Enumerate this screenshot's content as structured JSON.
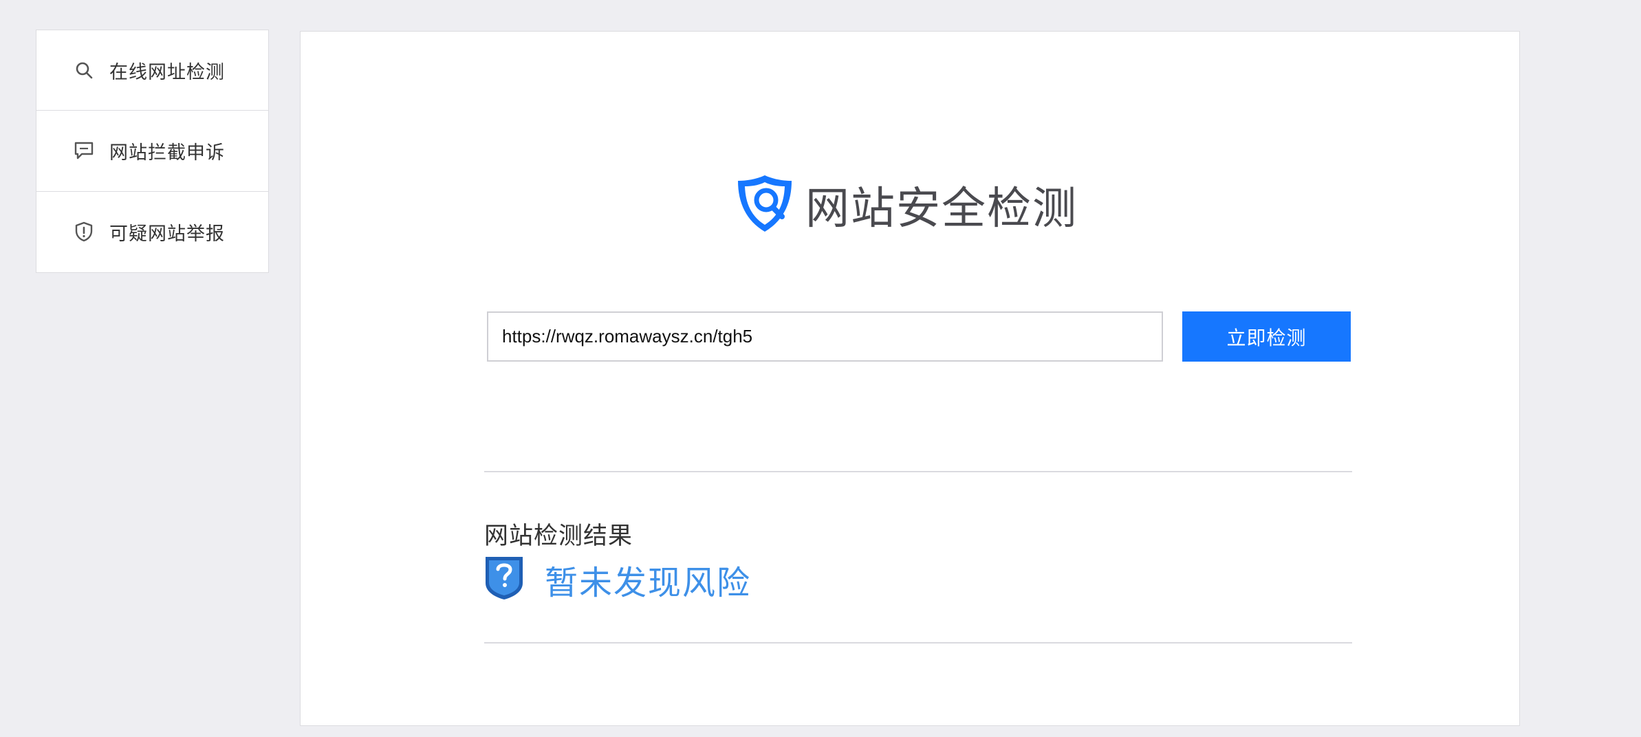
{
  "sidebar": {
    "items": [
      {
        "label": "在线网址检测",
        "icon": "search-icon"
      },
      {
        "label": "网站拦截申诉",
        "icon": "comment-icon"
      },
      {
        "label": "可疑网站举报",
        "icon": "shield-alert-icon"
      }
    ]
  },
  "main": {
    "brand_title": "网站安全检测",
    "url_input": {
      "value": "https://rwqz.romawaysz.cn/tgh5",
      "placeholder": ""
    },
    "check_button": "立即检测",
    "result": {
      "heading": "网站检测结果",
      "status": "暂未发现风险"
    }
  },
  "colors": {
    "accent": "#1677ff",
    "result_text": "#3e90e8",
    "background": "#eeeef2"
  }
}
